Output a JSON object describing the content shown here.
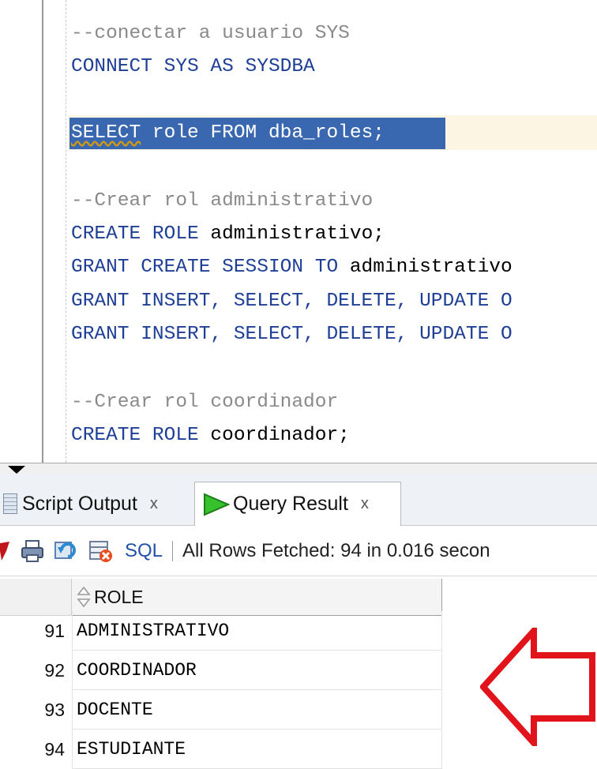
{
  "editor": {
    "lines": {
      "comment_connect": "--conectar a usuario SYS",
      "connect_kw": "CONNECT SYS AS SYSDBA",
      "select_kw1": "SELECT",
      "select_id1": " role ",
      "select_kw2": "FROM",
      "select_id2": " dba_roles;",
      "comment_admin": "--Crear rol administrativo",
      "create_admin_kw": "CREATE ROLE",
      "create_admin_id": " administrativo;",
      "grant_session_kw": "GRANT CREATE SESSION TO",
      "grant_session_id": " administrativo",
      "grant_insert_1": "GRANT INSERT, SELECT, DELETE, UPDATE O",
      "grant_insert_2": "GRANT INSERT, SELECT, DELETE, UPDATE O",
      "comment_coord": "--Crear rol coordinador",
      "create_coord_kw": "CREATE ROLE",
      "create_coord_id": " coordinador;"
    }
  },
  "tabs": {
    "script_output": "Script Output",
    "query_result": "Query Result",
    "close_glyph": "x"
  },
  "toolbar": {
    "sql_label": "SQL",
    "status": "All Rows Fetched: 94 in 0.016 secon"
  },
  "grid": {
    "column_header": "ROLE",
    "rows": [
      {
        "num": "91",
        "role": "ADMINISTRATIVO"
      },
      {
        "num": "92",
        "role": "COORDINADOR"
      },
      {
        "num": "93",
        "role": "DOCENTE"
      },
      {
        "num": "94",
        "role": "ESTUDIANTE"
      }
    ]
  },
  "colors": {
    "keyword": "#1f3f96",
    "comment": "#8a8a8a",
    "selection": "#3968b1",
    "current_line": "#fdf5e3",
    "annotation_arrow": "#e0141a"
  }
}
